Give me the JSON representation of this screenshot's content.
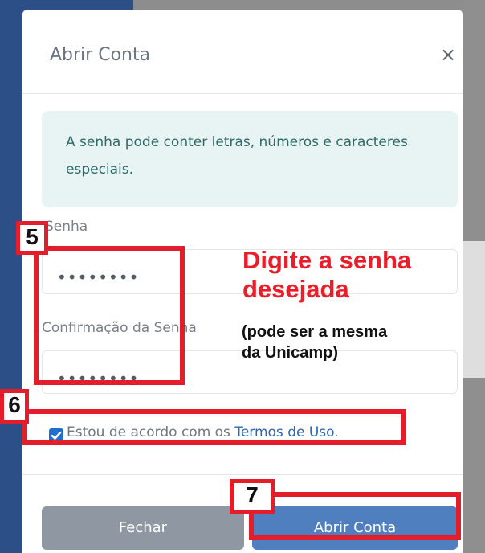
{
  "modal": {
    "title": "Abrir Conta",
    "close_glyph": "×",
    "alert_text": "A senha pode conter letras, números e caracteres especiais.",
    "password_label": "Senha",
    "password_value": "••••••••",
    "confirm_label": "Confirmação da Senha",
    "confirm_value": "••••••••",
    "terms_prefix": "Estou de acordo com os",
    "terms_link": "Termos de Uso",
    "terms_suffix": ".",
    "terms_checked": true,
    "buttons": {
      "fechar": "Fechar",
      "abrir": "Abrir Conta"
    }
  },
  "annotations": {
    "step5": "5",
    "step6": "6",
    "step7": "7",
    "main_line1": "Digite a senha",
    "main_line2": "desejada",
    "sub_line1": "(pode ser a mesma",
    "sub_line2": "da Unicamp)"
  },
  "icons": {
    "close": "close-icon",
    "checkbox": "checkbox-checked-icon"
  },
  "colors": {
    "primary": "#4f7fbe",
    "secondary": "#8f97a3",
    "alert_bg": "#e8f4f3",
    "alert_text": "#2e6a68",
    "annotation_red": "#e31d2a"
  }
}
